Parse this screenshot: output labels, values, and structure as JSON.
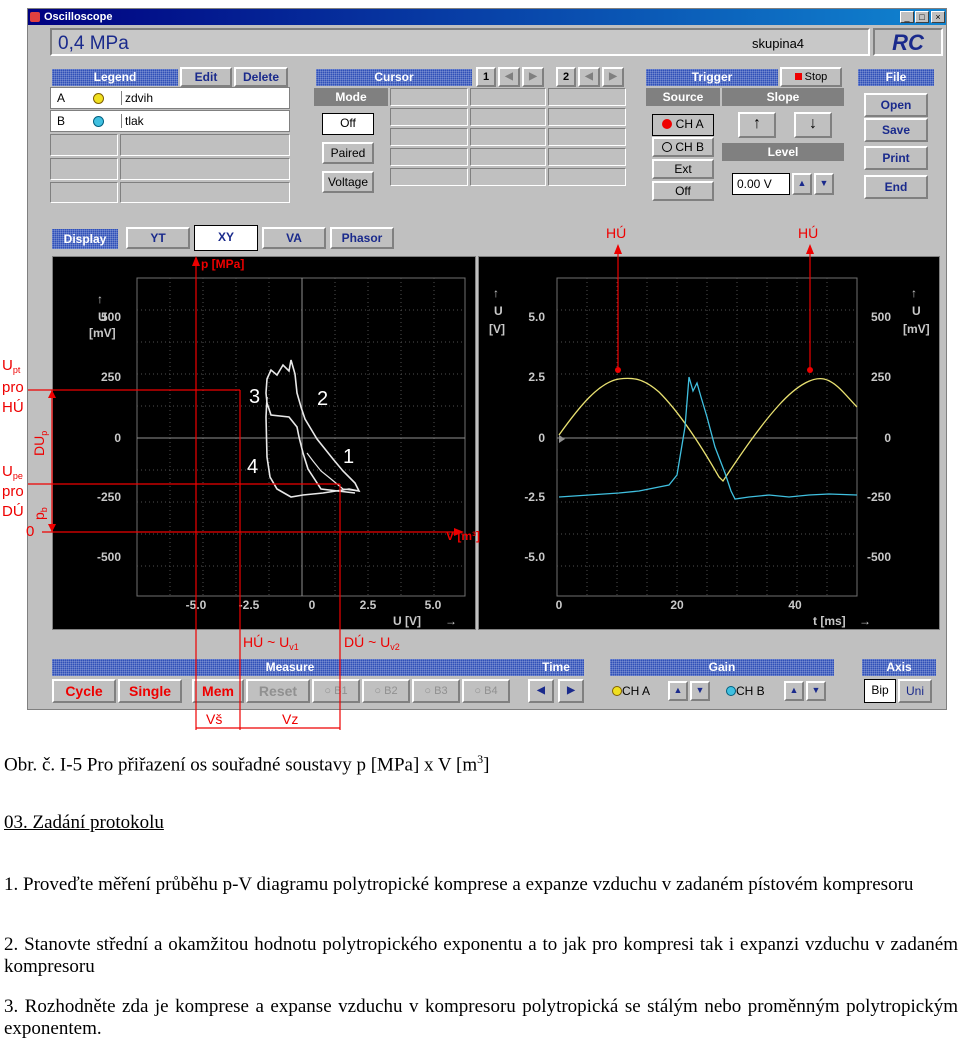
{
  "window": {
    "title": "Oscilloscope"
  },
  "header": {
    "value": "0,4 MPa",
    "group": "skupina4",
    "logo": "RC"
  },
  "legend": {
    "title": "Legend",
    "edit": "Edit",
    "delete": "Delete",
    "rows": [
      {
        "id": "A",
        "name": "zdvih",
        "color": "#f0e020"
      },
      {
        "id": "B",
        "name": "tlak",
        "color": "#40c0e0"
      }
    ]
  },
  "cursor": {
    "title": "Cursor",
    "n1": "1",
    "n2": "2",
    "mode": "Mode",
    "off": "Off",
    "paired": "Paired",
    "voltage": "Voltage"
  },
  "trigger": {
    "title": "Trigger",
    "stop": "Stop",
    "source": "Source",
    "slope": "Slope",
    "cha": "CH A",
    "chb": "CH B",
    "ext": "Ext",
    "off": "Off",
    "level": "Level",
    "level_value": "0.00 V",
    "up": "↑",
    "down": "↓"
  },
  "file": {
    "title": "File",
    "open": "Open",
    "save": "Save",
    "print": "Print",
    "end": "End"
  },
  "display": {
    "title": "Display",
    "tabs": [
      "YT",
      "XY",
      "VA",
      "Phasor"
    ],
    "active": "XY"
  },
  "xy": {
    "ylabel": "p [MPa]",
    "yunit1": "U",
    "yunit2": "[mV]",
    "yticks": [
      "500",
      "250",
      "0",
      "-250",
      "-500"
    ],
    "xticks": [
      "-5.0",
      "-2.5",
      "0",
      "2.5",
      "5.0"
    ],
    "xlabel": "U [V]",
    "vlabel": "V [m³]",
    "points": [
      "1",
      "2",
      "3",
      "4"
    ]
  },
  "yt": {
    "left_unit1": "U",
    "left_unit2": "[V]",
    "left_ticks": [
      "5.0",
      "2.5",
      "0",
      "-2.5",
      "-5.0"
    ],
    "right_unit1": "U",
    "right_unit2": "[mV]",
    "right_ticks": [
      "500",
      "250",
      "0",
      "-250",
      "-500"
    ],
    "xticks": [
      "0",
      "20",
      "40"
    ],
    "xlabel": "t [ms]",
    "marker": "HÚ"
  },
  "annotations": {
    "upt1": "U",
    "upt1sub": "pt",
    "upt2": "pro",
    "upt3": "HÚ",
    "dup": "DU",
    "dupsub": "p",
    "upe1": "U",
    "upe1sub": "pe",
    "upe2": "pro",
    "upe3": "DÚ",
    "pb": "p",
    "pbsub": "b",
    "zero": "0",
    "hu_uv1": "HÚ ~ U",
    "hu_sub": "v1",
    "du_uv2": "DÚ ~ U",
    "du_sub": "v2",
    "vs": "Vš",
    "vz": "Vz"
  },
  "measure": {
    "title": "Measure",
    "cycle": "Cycle",
    "single": "Single",
    "mem": "Mem",
    "reset": "Reset",
    "b": [
      "B1",
      "B2",
      "B3",
      "B4"
    ]
  },
  "time": {
    "title": "Time"
  },
  "gain": {
    "title": "Gain",
    "cha": "CH A",
    "chb": "CH B"
  },
  "axis": {
    "title": "Axis",
    "bip": "Bip",
    "uni": "Uni"
  },
  "caption": {
    "text": "Obr. č. I-5 Pro přiřazení os souřadné soustavy p [MPa] x V [m",
    "sup": "3",
    "end": "]"
  },
  "section": "03. Zadání protokolu",
  "items": [
    "1.  Proveďte měření průběhu p-V diagramu polytropické komprese a expanze vzduchu v zadaném pístovém kompresoru",
    "2.  Stanovte střední a okamžitou hodnotu polytropického exponentu a to jak pro kompresi tak i expanzi vzduchu v zadaném kompresoru",
    "3.  Rozhodněte zda je komprese a expanse vzduchu v kompresoru polytropická se stálým nebo proměnným polytropickým exponentem."
  ],
  "colors": {
    "accent": "#e00000",
    "cha": "#f0e020",
    "chb": "#40c0e0",
    "header": "#3050b8"
  }
}
